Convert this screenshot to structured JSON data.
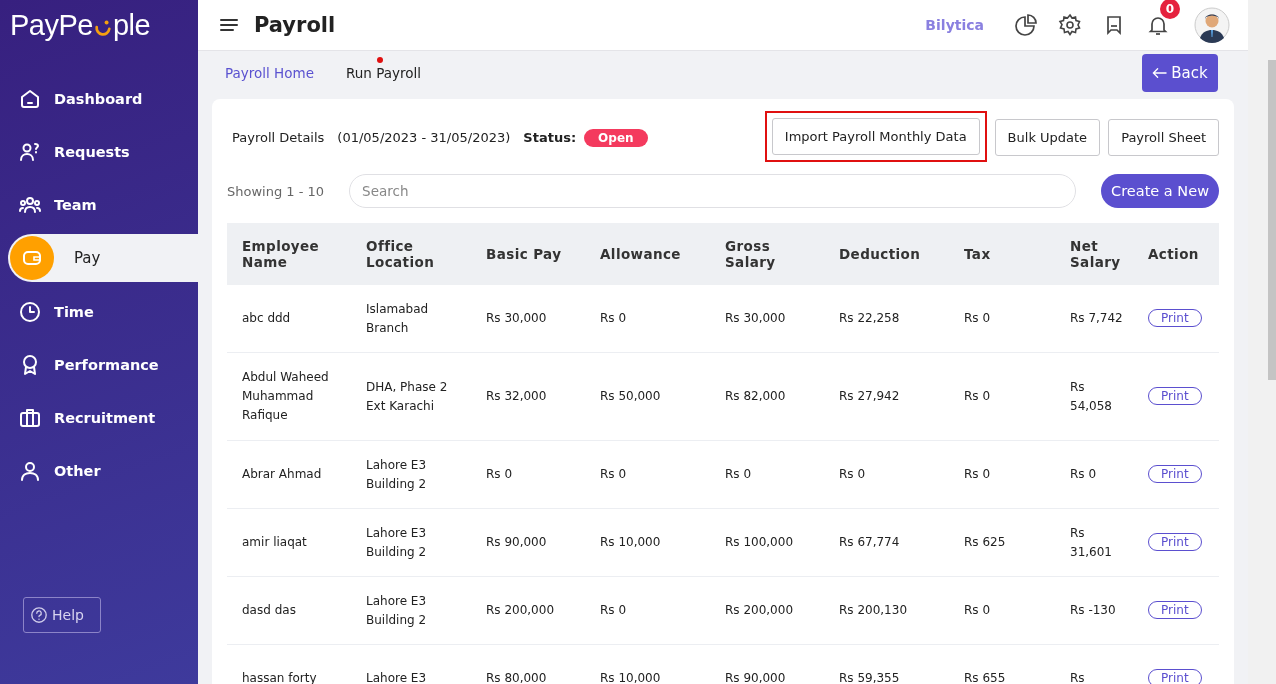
{
  "logo": {
    "text_start": "PayPe",
    "text_end": "ple"
  },
  "sidebar": {
    "items": [
      {
        "label": "Dashboard",
        "selected": false
      },
      {
        "label": "Requests",
        "selected": false
      },
      {
        "label": "Team",
        "selected": false
      },
      {
        "label": "Pay",
        "selected": true
      },
      {
        "label": "Time",
        "selected": false
      },
      {
        "label": "Performance",
        "selected": false
      },
      {
        "label": "Recruitment",
        "selected": false
      },
      {
        "label": "Other",
        "selected": false
      }
    ],
    "help": "Help"
  },
  "header": {
    "title": "Payroll",
    "company": "Bilytica",
    "notifications": "0"
  },
  "breadcrumbs": [
    {
      "label": "Payroll Home",
      "selected": false
    },
    {
      "label": "Run Payroll",
      "selected": true
    }
  ],
  "back_button": "Back",
  "details": {
    "label": "Payroll Details",
    "period": "(01/05/2023 - 31/05/2023)",
    "status_label": "Status:",
    "status": "Open"
  },
  "actions": [
    {
      "label": "Import Payroll Monthly Data",
      "highlighted": true
    },
    {
      "label": "Bulk Update",
      "highlighted": false
    },
    {
      "label": "Payroll Sheet",
      "highlighted": false
    }
  ],
  "showing": "Showing 1 - 10",
  "search": {
    "placeholder": "Search"
  },
  "create_button": "Create a New",
  "table": {
    "columns": [
      "Employee Name",
      "Office Location",
      "Basic Pay",
      "Allowance",
      "Gross Salary",
      "Deduction",
      "Tax",
      "Net Salary",
      "Action"
    ],
    "rows": [
      {
        "cells": [
          "abc ddd",
          "Islamabad Branch",
          "Rs 30,000",
          "Rs 0",
          "Rs 30,000",
          "Rs 22,258",
          "Rs 0",
          "Rs 7,742"
        ],
        "action": "Print"
      },
      {
        "cells": [
          "Abdul Waheed Muhammad Rafique",
          "DHA, Phase 2 Ext Karachi",
          "Rs 32,000",
          "Rs 50,000",
          "Rs 82,000",
          "Rs 27,942",
          "Rs 0",
          "Rs 54,058"
        ],
        "action": "Print"
      },
      {
        "cells": [
          "Abrar Ahmad",
          "Lahore E3 Building 2",
          "Rs 0",
          "Rs 0",
          "Rs 0",
          "Rs 0",
          "Rs 0",
          "Rs 0"
        ],
        "action": "Print"
      },
      {
        "cells": [
          "amir liaqat",
          "Lahore E3 Building 2",
          "Rs 90,000",
          "Rs 10,000",
          "Rs 100,000",
          "Rs 67,774",
          "Rs 625",
          "Rs 31,601"
        ],
        "action": "Print"
      },
      {
        "cells": [
          "dasd das",
          "Lahore E3 Building 2",
          "Rs 200,000",
          "Rs 0",
          "Rs 200,000",
          "Rs 200,130",
          "Rs 0",
          "Rs -130"
        ],
        "action": "Print"
      },
      {
        "cells": [
          "hassan forty",
          "Lahore E3",
          "Rs 80,000",
          "Rs 10,000",
          "Rs 90,000",
          "Rs 59,355",
          "Rs 655",
          "Rs"
        ],
        "action": "Print"
      }
    ]
  }
}
